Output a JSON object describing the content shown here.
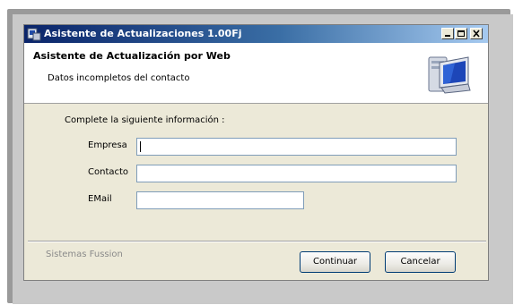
{
  "window": {
    "title": "Asistente de Actualizaciones 1.00Fj",
    "controls": {
      "minimize_icon": "minimize-icon",
      "maximize_icon": "maximize-icon",
      "close_icon": "close-icon"
    }
  },
  "header": {
    "title": "Asistente de Actualización por Web",
    "subtitle": "Datos incompletos del contacto",
    "icon": "computer-update-icon"
  },
  "form": {
    "intro": "Complete la siguiente información :",
    "fields": [
      {
        "label": "Empresa",
        "value": "",
        "focused": true
      },
      {
        "label": "Contacto",
        "value": ""
      },
      {
        "label": "EMail",
        "value": ""
      }
    ]
  },
  "footer": {
    "brand": "Sistemas Fussion",
    "continue_label": "Continuar",
    "cancel_label": "Cancelar"
  },
  "colors": {
    "title_gradient_start": "#0a246a",
    "title_gradient_end": "#a6caf0",
    "dialog_bg": "#ece9d8",
    "field_border": "#7f9db9",
    "button_border": "#003c74"
  }
}
